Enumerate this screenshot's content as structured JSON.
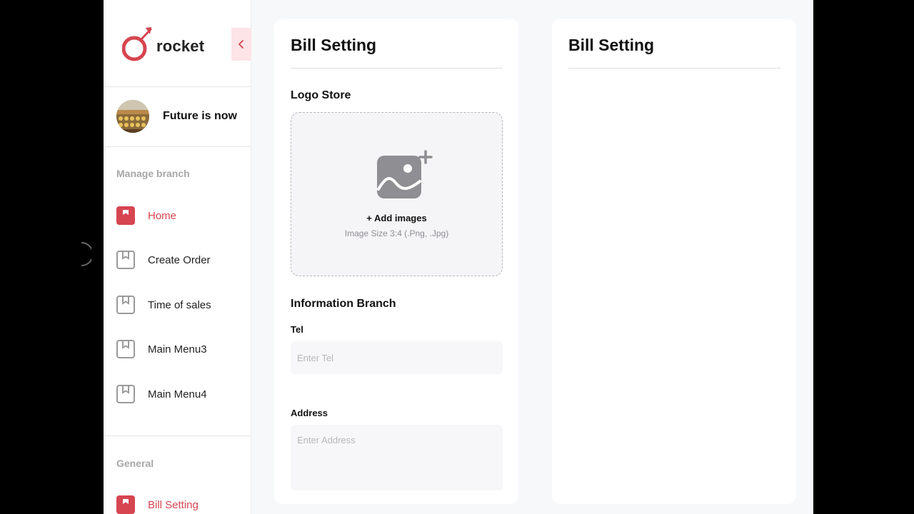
{
  "brand": {
    "name": "rocket",
    "accent": "#d64550"
  },
  "profile": {
    "name": "Future is now"
  },
  "sidebar": {
    "sections": [
      {
        "label": "Manage branch"
      },
      {
        "label": "General"
      }
    ],
    "items": [
      {
        "label": "Home",
        "icon": "bookmark-icon",
        "active": true
      },
      {
        "label": "Create Order",
        "icon": "bookmark-icon",
        "active": false
      },
      {
        "label": "Time of sales",
        "icon": "bookmark-icon",
        "active": false
      },
      {
        "label": "Main Menu3",
        "icon": "bookmark-icon",
        "active": false
      },
      {
        "label": "Main Menu4",
        "icon": "bookmark-icon",
        "active": false
      },
      {
        "label": "Bill Setting",
        "icon": "bookmark-icon",
        "active": true
      }
    ]
  },
  "settings_card": {
    "title": "Bill Setting",
    "logo_section": "Logo Store",
    "upload": {
      "label": "+ Add images",
      "hint": "Image Size 3:4 (.Png, .Jpg)"
    },
    "info_section": "Information Branch",
    "tel": {
      "label": "Tel",
      "placeholder": "Enter Tel",
      "value": ""
    },
    "address": {
      "label": "Address",
      "placeholder": "Enter Address",
      "value": ""
    }
  },
  "preview_card": {
    "title": "Bill Setting"
  }
}
